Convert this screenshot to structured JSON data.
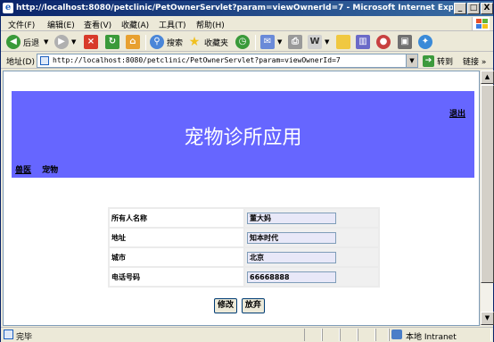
{
  "window": {
    "title": "http://localhost:8080/petclinic/PetOwnerServlet?param=viewOwnerId=7 - Microsoft Internet Explorer",
    "min_label": "_",
    "max_label": "□",
    "close_label": "X"
  },
  "menu": {
    "items": [
      "文件(F)",
      "编辑(E)",
      "查看(V)",
      "收藏(A)",
      "工具(T)",
      "帮助(H)"
    ]
  },
  "toolbar": {
    "back_label": "后退",
    "search_label": "搜索",
    "favorites_label": "收藏夹"
  },
  "address": {
    "label": "地址(D)",
    "url": "http://localhost:8080/petclinic/PetOwnerServlet?param=viewOwnerId=7",
    "go_label": "转到",
    "links_label": "链接 »"
  },
  "page": {
    "logout": "退出",
    "title": "宠物诊所应用",
    "nav": {
      "vets": "兽医",
      "pets": "宠物"
    },
    "form": {
      "rows": [
        {
          "label": "所有人名称",
          "value": "董大妈"
        },
        {
          "label": "地址",
          "value": "知本时代"
        },
        {
          "label": "城市",
          "value": "北京"
        },
        {
          "label": "电话号码",
          "value": "66668888"
        }
      ],
      "modify_button": "修改",
      "cancel_button": "放弃"
    }
  },
  "status": {
    "text": "完毕",
    "zone": "本地 Intranet"
  },
  "colors": {
    "header_bg": "#6666ff",
    "titlebar_start": "#0a246a",
    "titlebar_end": "#3a6ea5"
  }
}
